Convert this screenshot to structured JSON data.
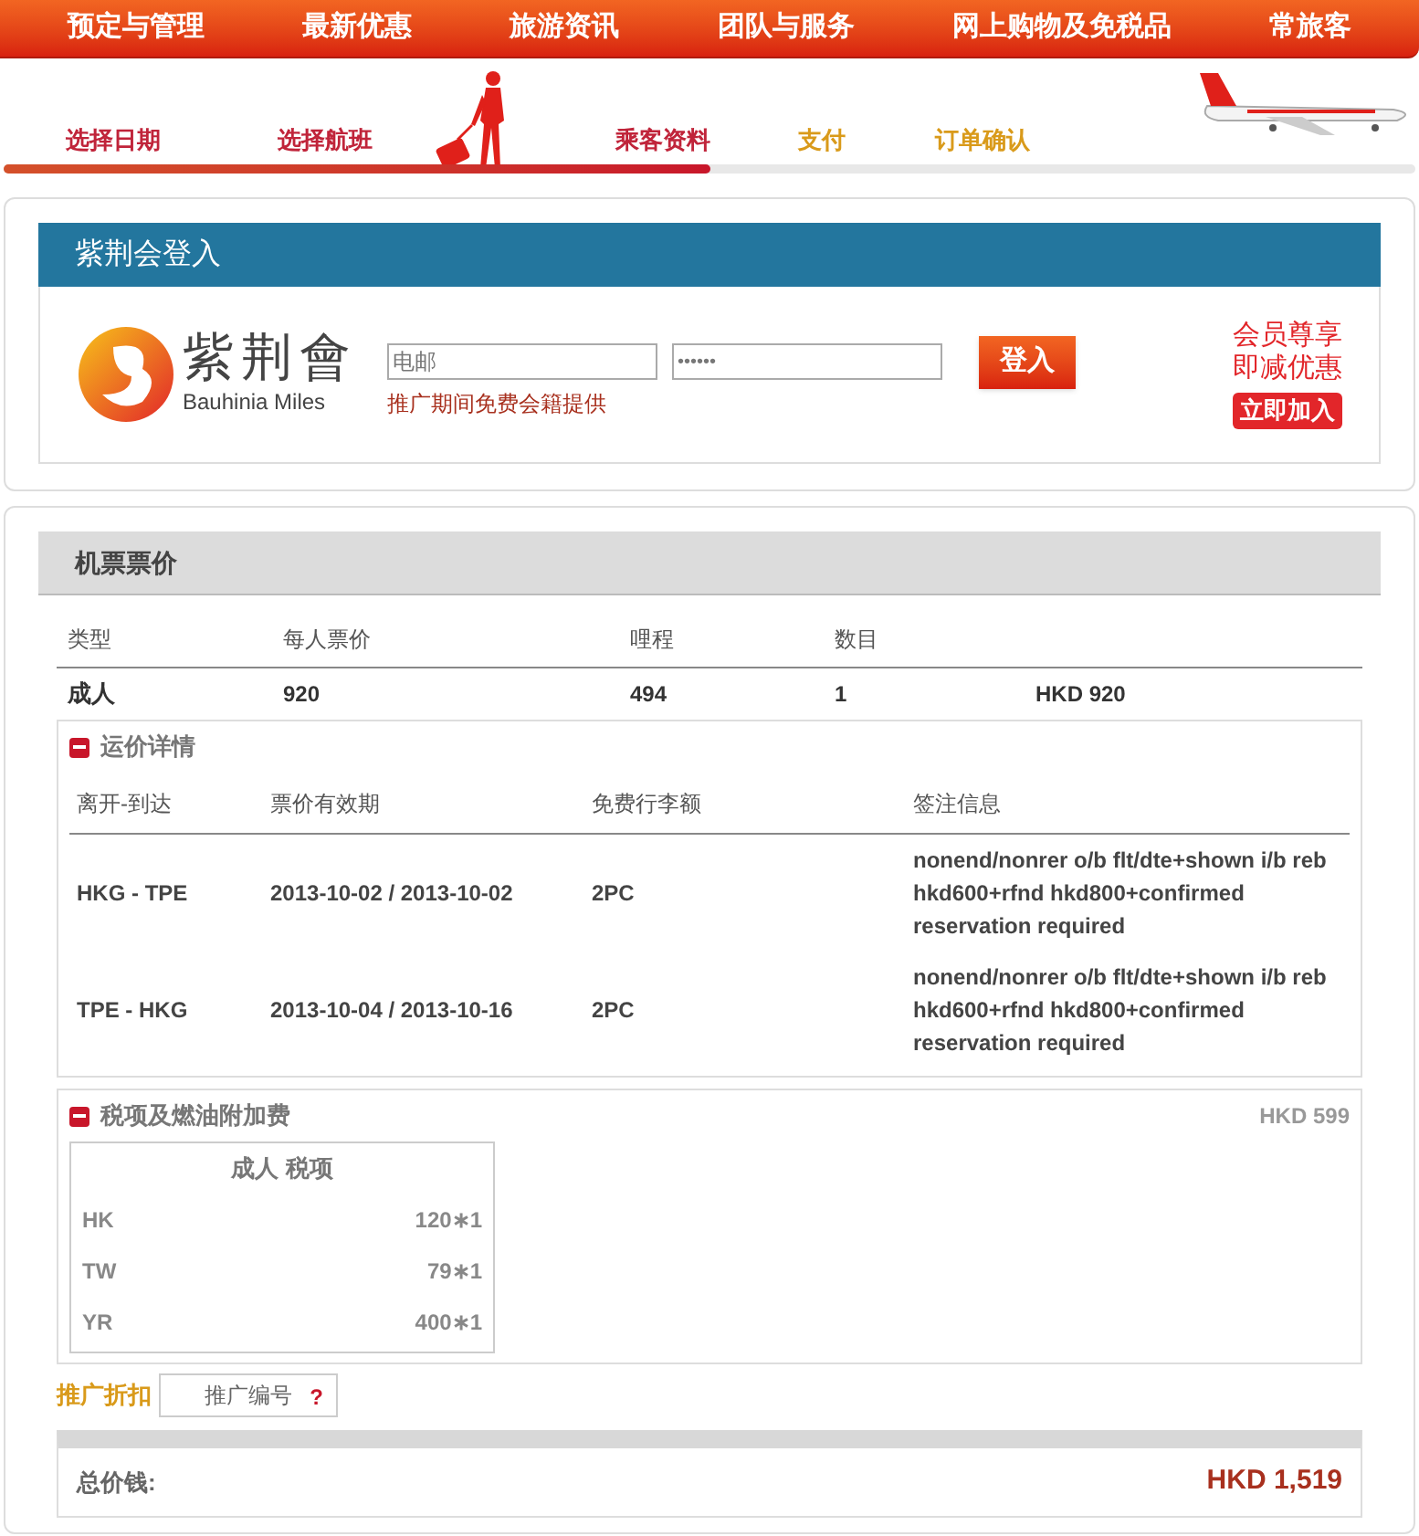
{
  "nav": [
    "预定与管理",
    "最新优惠",
    "旅游资讯",
    "团队与服务",
    "网上购物及免税品",
    "常旅客"
  ],
  "steps": [
    {
      "label": "选择日期",
      "done": true
    },
    {
      "label": "选择航班",
      "done": true
    },
    {
      "label": "乘客资料",
      "done": true
    },
    {
      "label": "支付",
      "done": false
    },
    {
      "label": "订单确认",
      "done": false
    }
  ],
  "progress": {
    "level": 0.5
  },
  "login": {
    "title": "紫荆会登入",
    "logo_name": "紫荆會",
    "logo_sub": "Bauhinia Miles",
    "email": {
      "placeholder": "电邮"
    },
    "password": {
      "value": "••••••"
    },
    "button": "登入",
    "note": "推广期间免费会籍提供",
    "promo_line1": "会员尊享",
    "promo_line2": "即减优惠",
    "join": "立即加入"
  },
  "fare": {
    "title": "机票票价",
    "columns": [
      "类型",
      "每人票价",
      "哩程",
      "数目"
    ],
    "rows": [
      {
        "type": "成人",
        "price": "920",
        "miles": "494",
        "count": "1",
        "total": "HKD 920"
      }
    ],
    "details": {
      "title": "运价详情",
      "expanded": true,
      "columns": [
        "离开-到达",
        "票价有效期",
        "免费行李额",
        "签注信息"
      ],
      "rows": [
        {
          "route": "HKG - TPE",
          "validity": "2013-10-02 / 2013-10-02",
          "baggage": "2PC",
          "remarks": "nonend/nonrer o/b flt/dte+shown i/b reb hkd600+rfnd hkd800+confirmed reservation required"
        },
        {
          "route": "TPE - HKG",
          "validity": "2013-10-04 / 2013-10-16",
          "baggage": "2PC",
          "remarks": "nonend/nonrer o/b flt/dte+shown i/b reb hkd600+rfnd hkd800+confirmed reservation required"
        }
      ]
    },
    "taxes": {
      "title": "税项及燃油附加费",
      "expanded": true,
      "amount": "HKD 599",
      "table_title": "成人 税项",
      "rows": [
        {
          "code": "HK",
          "amount": "120∗1"
        },
        {
          "code": "TW",
          "amount": "79∗1"
        },
        {
          "code": "YR",
          "amount": "400∗1"
        }
      ]
    },
    "promo": {
      "label": "推广折扣",
      "placeholder": "推广编号",
      "help": "?"
    },
    "total": {
      "label": "总价钱:",
      "amount": "HKD 1,519"
    }
  }
}
